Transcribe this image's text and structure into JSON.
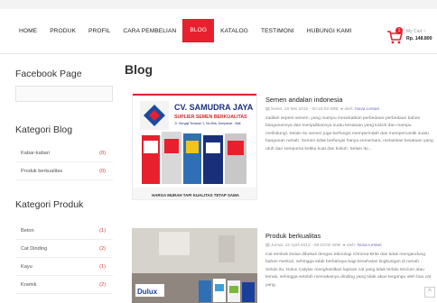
{
  "nav": {
    "items": [
      "HOME",
      "PRODUK",
      "PROFIL",
      "CARA PEMBELIAN",
      "BLOG",
      "KATALOG",
      "TESTIMONI",
      "HUBUNGI KAMI"
    ],
    "active": "BLOG"
  },
  "cart": {
    "label": "My Cart ~",
    "amount": "Rp. 148.800",
    "badge": "1"
  },
  "sidebar": {
    "facebook_title": "Facebook Page",
    "kategori_blog_title": "Kategori Blog",
    "kategori_blog": [
      {
        "label": "Kabar-kabari",
        "count": "(0)"
      },
      {
        "label": "Produk berkualitas",
        "count": "(0)"
      }
    ],
    "kategori_produk_title": "Kategori Produk",
    "kategori_produk": [
      {
        "label": "Beton",
        "count": "(1)"
      },
      {
        "label": "Cat Dinding",
        "count": "(2)"
      },
      {
        "label": "Kayu",
        "count": "(1)"
      },
      {
        "label": "Kramik",
        "count": "(2)"
      }
    ]
  },
  "main": {
    "title": "Blog",
    "posts": [
      {
        "title": "Semen andalan indonesia",
        "date": "Senin, 18 Mei 2015 - 00:15:00 WIB",
        "author_prefix": "oleh:",
        "author": "Nova Lestari",
        "excerpt": "Jadilah seperti semen, yang mampu menekatkan perbedaan-perbedaan bahan bangunannya dan menjadikannya suatu kesatuan yang kokoh dan mampu melindungi. Selain itu semen juga berfungsi memperindah dan mempercantik suatu bangunan rumah. Semen tidak berfungsi hanya sementara, melainkan kesatuan yang utuh dan sempurna ketika kuat dan kokoh. Selain itu...",
        "image": {
          "company": "CV. SAMUDRA JAYA",
          "tagline": "SUPLIER SEMEN BERKUALITAS",
          "address": "Jl. Gergaji Tenaran 1, No.89a, Denpasar - Bali",
          "footer": "HARGA MURAH TAPI KUALITAS TETAP SAMA"
        }
      },
      {
        "title": "Produk berkualitas",
        "date": "Jumat, 12 April 2013 - 09:10:00 WIB",
        "author_prefix": "oleh:",
        "author": "Nova Lestari",
        "excerpt": "Cat tembok Dulux dibekali dengan teknologi Chroma-Brite dan tidak mengandung bahan merkuri, sehingga tidak berbahaya bagi kesehatan lingkungan di rumah. Selain itu, Dulux Catylac menghasilkan lapisan cat yang tidak terlalu tercium atau lemak, sehingga setelah memakainya dinding yang tidak akan tergangu oleh bau cat yang.",
        "image": {
          "brand": "Dulux"
        }
      }
    ]
  },
  "scroll_top": "^",
  "colors": {
    "accent": "#e8202e",
    "count": "#c73a3a"
  }
}
